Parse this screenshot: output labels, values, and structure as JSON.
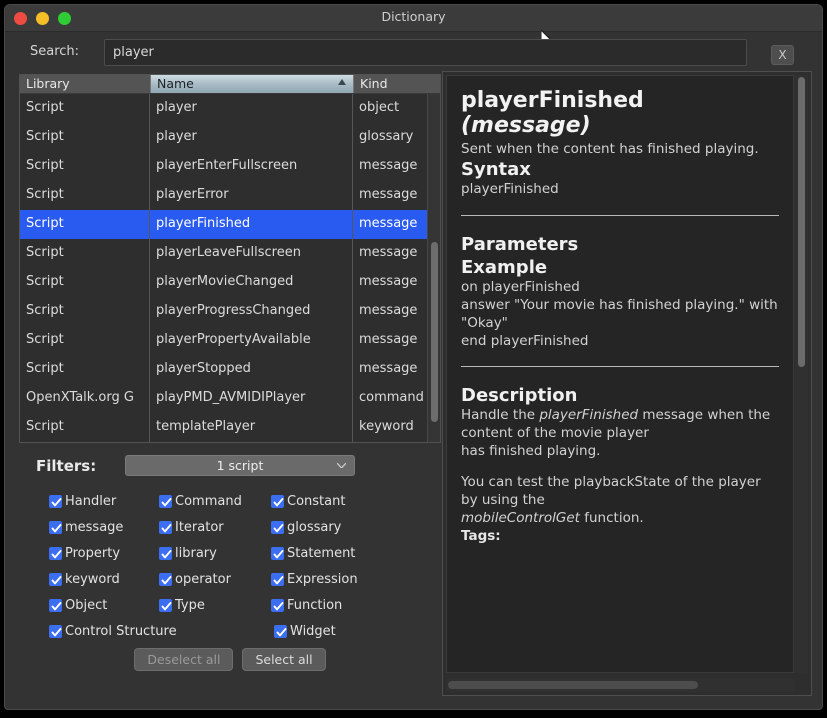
{
  "window": {
    "title": "Dictionary",
    "traffic_lights": [
      "close-red",
      "minimize-yellow",
      "maximize-green"
    ]
  },
  "search": {
    "label": "Search:",
    "value": "player",
    "placeholder": "",
    "clear_label": "X"
  },
  "list": {
    "columns": [
      "Library",
      "Name",
      "Kind"
    ],
    "sorted_column": "Name",
    "sort_direction": "ascending",
    "selected_index": 4,
    "rows": [
      {
        "library": "Script",
        "name": "player",
        "kind": "object"
      },
      {
        "library": "Script",
        "name": "player",
        "kind": "glossary"
      },
      {
        "library": "Script",
        "name": "playerEnterFullscreen",
        "kind": "message"
      },
      {
        "library": "Script",
        "name": "playerError",
        "kind": "message"
      },
      {
        "library": "Script",
        "name": "playerFinished",
        "kind": "message"
      },
      {
        "library": "Script",
        "name": "playerLeaveFullscreen",
        "kind": "message"
      },
      {
        "library": "Script",
        "name": "playerMovieChanged",
        "kind": "message"
      },
      {
        "library": "Script",
        "name": "playerProgressChanged",
        "kind": "message"
      },
      {
        "library": "Script",
        "name": "playerPropertyAvailable",
        "kind": "message"
      },
      {
        "library": "Script",
        "name": "playerStopped",
        "kind": "message"
      },
      {
        "library": "OpenXTalk.org G",
        "name": "playPMD_AVMIDIPlayer",
        "kind": "command"
      },
      {
        "library": "Script",
        "name": "templatePlayer",
        "kind": "keyword"
      }
    ]
  },
  "filters": {
    "label": "Filters:",
    "script_select_value": "1 script",
    "checkboxes": [
      [
        {
          "label": "Handler",
          "checked": true
        },
        {
          "label": "Command",
          "checked": true
        },
        {
          "label": "Constant",
          "checked": true
        }
      ],
      [
        {
          "label": "message",
          "checked": true
        },
        {
          "label": "Iterator",
          "checked": true
        },
        {
          "label": "glossary",
          "checked": true
        }
      ],
      [
        {
          "label": "Property",
          "checked": true
        },
        {
          "label": "library",
          "checked": true
        },
        {
          "label": "Statement",
          "checked": true
        }
      ],
      [
        {
          "label": "keyword",
          "checked": true
        },
        {
          "label": "operator",
          "checked": true
        },
        {
          "label": "Expression",
          "checked": true
        }
      ],
      [
        {
          "label": "Object",
          "checked": true
        },
        {
          "label": "Type",
          "checked": true
        },
        {
          "label": "Function",
          "checked": true
        }
      ]
    ],
    "last_row": [
      {
        "label": "Control Structure",
        "checked": true
      },
      {
        "label": "Widget",
        "checked": true
      }
    ],
    "deselect_all_label": "Deselect all",
    "select_all_label": "Select all"
  },
  "detail": {
    "title_name": "playerFinished",
    "title_kind": "(message)",
    "summary": "Sent when the content has finished playing.",
    "syntax_heading": "Syntax",
    "syntax_body": "playerFinished",
    "parameters_heading": "Parameters",
    "example_heading": "Example",
    "example_line1": "on playerFinished",
    "example_line2": "    answer \"Your movie has finished playing.\" with \"Okay\"",
    "example_line3": "end playerFinished",
    "description_heading": "Description",
    "description_p1_pre": "Handle the ",
    "description_p1_em": "playerFinished",
    "description_p1_post": " message when the content of the movie player",
    "description_p1_line2": "has finished playing.",
    "description_p2_pre": "You can test the playbackState of the player by using the",
    "description_p2_em": "mobileControlGet",
    "description_p2_post": " function.",
    "tags_label": "Tags:"
  },
  "colors": {
    "window_bg": "#333333",
    "titlebar": "#3b3b3b",
    "list_bg": "#2e2e2e",
    "selection": "#2a5bf0",
    "checkbox": "#3b6ef0",
    "detail_bg": "#252525",
    "header_active": "#a9bcc6"
  }
}
